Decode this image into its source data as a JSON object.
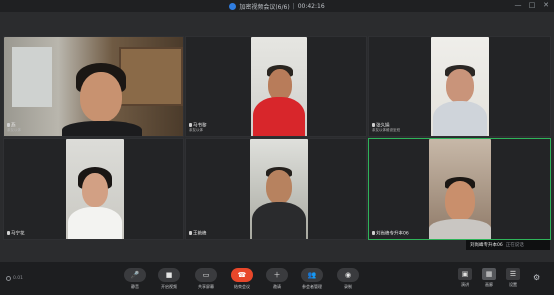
{
  "window": {
    "title": "加密视频会议(6/6)",
    "separator": "|",
    "timer": "00:42:16",
    "minimize_icon": "—",
    "maximize_icon": "□",
    "close_icon": "✕"
  },
  "participants": [
    {
      "name": "燕",
      "sub": "亲友以体",
      "speaking": false
    },
    {
      "name": "马书黎",
      "sub": "亲友以体",
      "speaking": false
    },
    {
      "name": "张久娟",
      "sub": "亲友以体维设坐班",
      "speaking": false
    },
    {
      "name": "马宁花",
      "sub": "",
      "speaking": false
    },
    {
      "name": "王艳峰",
      "sub": "",
      "speaking": false
    },
    {
      "name": "刘尚峰专升本06",
      "sub": "",
      "speaking": true
    }
  ],
  "speaking_indicator": {
    "name": "刘尚峰专升本06",
    "status": "正在说话"
  },
  "toolbar": {
    "left_status": "0.01",
    "buttons": [
      {
        "label": "静音",
        "icon": "mic-icon"
      },
      {
        "label": "开启视频",
        "icon": "camera-icon"
      },
      {
        "label": "共享屏幕",
        "icon": "screen-share-icon"
      },
      {
        "label": "结束会议",
        "icon": "hangup-icon"
      },
      {
        "label": "邀请",
        "icon": "invite-icon"
      },
      {
        "label": "参会者管理",
        "icon": "participants-icon"
      },
      {
        "label": "录制",
        "icon": "record-icon"
      }
    ],
    "right": [
      {
        "label": "演讲",
        "icon": "speaker-view-icon"
      },
      {
        "label": "画廊",
        "icon": "gallery-view-icon"
      },
      {
        "label": "设置",
        "icon": "more-icon"
      }
    ],
    "settings_glyph": "⚙"
  },
  "colors": {
    "accent_green": "#2fb45a",
    "hangup_red": "#e8472a",
    "background": "#2b2c2e"
  }
}
